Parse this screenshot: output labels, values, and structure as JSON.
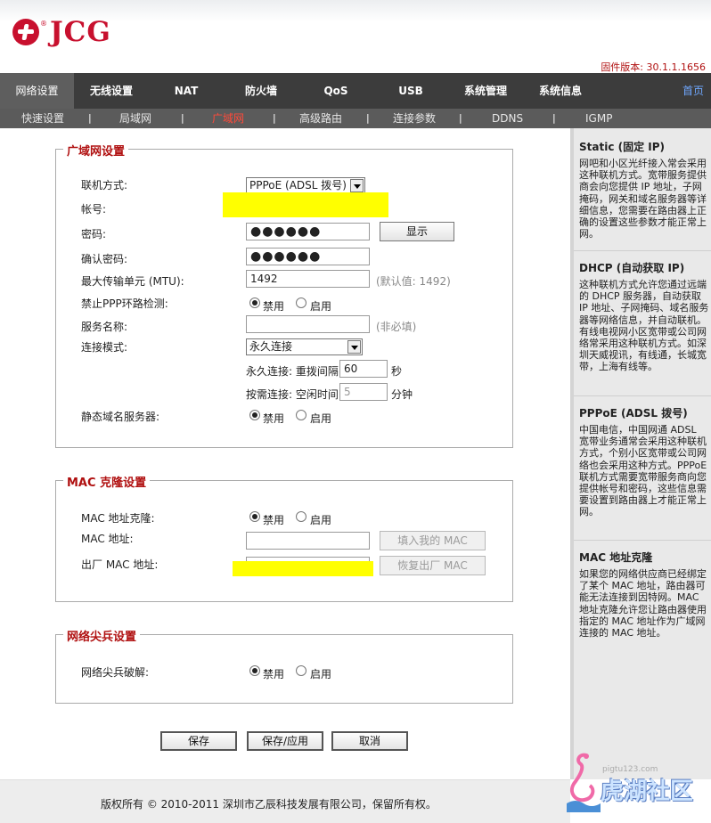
{
  "brand": {
    "name": "JCG",
    "reg": "®"
  },
  "firmware": "固件版本: 30.1.1.1656",
  "nav": {
    "items": [
      "网络设置",
      "无线设置",
      "NAT",
      "防火墙",
      "QoS",
      "USB",
      "系统管理",
      "系统信息"
    ],
    "home": "首页"
  },
  "subnav": {
    "items": [
      "快速设置",
      "局域网",
      "广域网",
      "高级路由",
      "连接参数",
      "DDNS",
      "IGMP"
    ],
    "sep": "|"
  },
  "wan": {
    "legend": "广域网设置",
    "conn_label": "联机方式:",
    "conn_value": "PPPoE (ADSL 拨号)",
    "account_label": "帐号:",
    "password_label": "密码:",
    "password_value": "●●●●●●",
    "show_btn": "显示",
    "confirm_label": "确认密码:",
    "confirm_value": "●●●●●●",
    "mtu_label": "最大传输单元 (MTU):",
    "mtu_value": "1492",
    "mtu_hint": "(默认值: 1492)",
    "ppp_loop_label": "禁止PPP环路检测:",
    "disable": "禁用",
    "enable": "启用",
    "service_label": "服务名称:",
    "service_hint": "(非必填)",
    "mode_label": "连接模式:",
    "mode_value": "永久连接",
    "redial_label": "永久连接: 重拨间隔",
    "redial_value": "60",
    "redial_unit": "秒",
    "idle_label": "按需连接: 空闲时间",
    "idle_value": "5",
    "idle_unit": "分钟",
    "dns_label": "静态域名服务器:"
  },
  "mac": {
    "legend": "MAC 克隆设置",
    "clone_label": "MAC 地址克隆:",
    "addr_label": "MAC 地址:",
    "fill_btn": "填入我的 MAC",
    "factory_label": "出厂 MAC 地址:",
    "restore_btn": "恢复出厂 MAC"
  },
  "spike": {
    "legend": "网络尖兵设置",
    "crack_label": "网络尖兵破解:"
  },
  "actions": {
    "save": "保存",
    "save_apply": "保存/应用",
    "cancel": "取消"
  },
  "sidebar": [
    {
      "title": "Static (固定 IP)",
      "text": "网吧和小区光纤接入常会采用这种联机方式。宽带服务提供商会向您提供 IP 地址，子网掩码，网关和域名服务器等详细信息，您需要在路由器上正确的设置这些参数才能正常上网。"
    },
    {
      "title": "DHCP (自动获取 IP)",
      "text": "这种联机方式允许您通过远端的 DHCP 服务器，自动获取 IP 地址、子网掩码、域名服务器等网络信息，并自动联机。有线电视网小区宽带或公司网络常采用这种联机方式。如深圳天威视讯，有线通，长城宽带，上海有线等。"
    },
    {
      "title": "PPPoE (ADSL 拨号)",
      "text": "中国电信，中国网通 ADSL 宽带业务通常会采用这种联机方式，个别小区宽带或公司网络也会采用这种方式。PPPoE 联机方式需要宽带服务商向您提供帐号和密码，这些信息需要设置到路由器上才能正常上网。"
    },
    {
      "title": "MAC 地址克隆",
      "text": "如果您的网络供应商已经绑定了某个 MAC 地址，路由器可能无法连接到因特网。MAC 地址克隆允许您让路由器使用指定的 MAC 地址作为广域网连接的 MAC 地址。"
    }
  ],
  "footer": "版权所有 © 2010-2011 深圳市乙辰科技发展有限公司，保留所有权。",
  "watermark": {
    "site": "pigtu123.com",
    "text": "虎湖社区"
  }
}
